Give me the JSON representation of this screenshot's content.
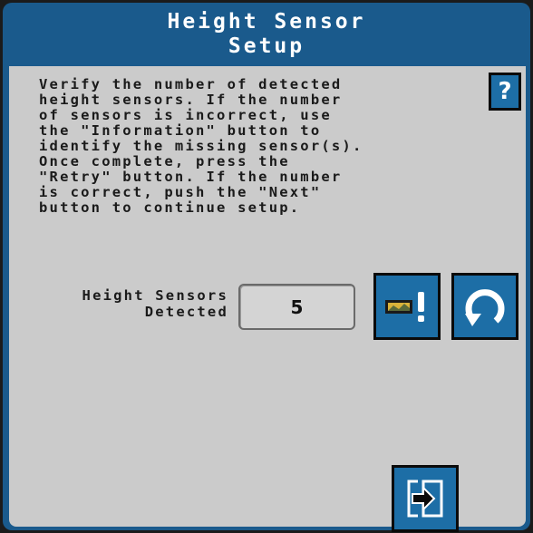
{
  "header": {
    "title_line1": "Height Sensor",
    "title_line2": "Setup"
  },
  "instructions": {
    "text": "Verify the number of detected\nheight sensors. If the number\nof sensors is incorrect, use\nthe \"Information\" button to\nidentify the missing sensor(s).\nOnce complete, press the\n\"Retry\" button. If the number\nis correct, push the \"Next\"\nbutton to continue setup."
  },
  "help_button": {
    "label": "?"
  },
  "sensors": {
    "label": "Height Sensors\nDetected",
    "count": "5"
  },
  "icons": {
    "help": "help-icon",
    "information": "sensor-information-icon",
    "retry": "retry-icon",
    "next": "next-icon"
  },
  "colors": {
    "title_bar": "#1a5a8c",
    "content_background": "#cbcbcb",
    "button": "#1d6ea6",
    "info_icon_accent": "#d9b23a"
  }
}
